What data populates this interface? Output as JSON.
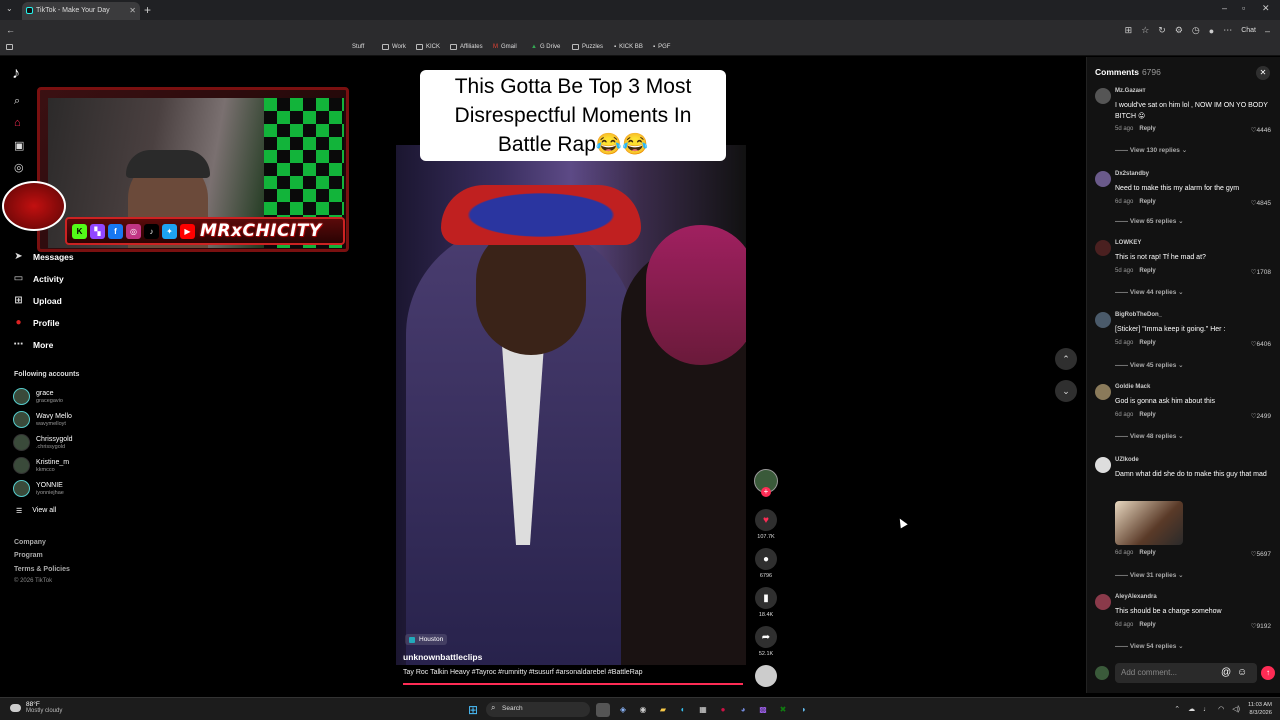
{
  "browser": {
    "tab_title": "TikTok - Make Your Day",
    "bookmarks": [
      "Stuff",
      "Work",
      "KICK",
      "Affiliates",
      "Gmail",
      "G Drive",
      "Puzzles",
      "KICK BB",
      "PGF"
    ],
    "chat_label": "Chat"
  },
  "sidebar": {
    "nav": [
      {
        "label": "Messages",
        "icon": "paper-plane-icon"
      },
      {
        "label": "Activity",
        "icon": "activity-icon"
      },
      {
        "label": "Upload",
        "icon": "upload-icon"
      },
      {
        "label": "Profile",
        "icon": "profile-icon"
      },
      {
        "label": "More",
        "icon": "more-icon"
      }
    ],
    "following_title": "Following accounts",
    "accounts": [
      {
        "name": "grace",
        "handle": "gracegavio"
      },
      {
        "name": "Wavy Mello",
        "handle": "wavymelloyt"
      },
      {
        "name": "Chrissygold",
        "handle": ".chrissygold"
      },
      {
        "name": "Kristine_m",
        "handle": "kkmcco"
      },
      {
        "name": "YONNIE",
        "handle": "iyonniejhae"
      }
    ],
    "view_all": "View all",
    "footer": [
      "Company",
      "Program",
      "Terms & Policies"
    ],
    "copyright": "© 2026 TikTok"
  },
  "overlay": {
    "channel_name": "MRxCHICITY"
  },
  "video": {
    "title_line1": "This Gotta Be Top 3 Most",
    "title_line2": "Disrespectful Moments In",
    "title_line3": "Battle Rap😂😂",
    "location": "Houston",
    "author": "unknownbattleclips",
    "caption": "Tay Roc Talkin Heavy #Tayroc #rumnitty #tsusurf #arsonaldarebel #BattleRap",
    "likes": "107.7K",
    "comments": "6796",
    "saves": "18.4K",
    "shares": "52.1K"
  },
  "comments_panel": {
    "title": "Comments",
    "count": "6796",
    "input_placeholder": "Add comment...",
    "items": [
      {
        "user": "Mz.Gazaнт",
        "text": "I would've sat on him lol , NOW IM ON YO BODY BITCH 😛",
        "age": "5d ago",
        "reply": "Reply",
        "likes": "4446",
        "replies": "View 130 replies"
      },
      {
        "user": "Dx2standby",
        "text": "Need to make this my alarm for the gym",
        "age": "6d ago",
        "reply": "Reply",
        "likes": "4845",
        "replies": "View 65 replies"
      },
      {
        "user": "LOWKEY",
        "text": "This is not rap! Tf he mad at?",
        "age": "5d ago",
        "reply": "Reply",
        "likes": "1708",
        "replies": "View 44 replies"
      },
      {
        "user": "BigRobTheDon_",
        "text": "[Sticker] \"Imma keep it going.\" Her :",
        "age": "5d ago",
        "reply": "Reply",
        "likes": "6406",
        "replies": "View 45 replies"
      },
      {
        "user": "Goldie Mack",
        "text": "God is gonna ask him about this",
        "age": "6d ago",
        "reply": "Reply",
        "likes": "2499",
        "replies": "View 48 replies"
      },
      {
        "user": "UZIkode",
        "text": "Damn what did she do to make this guy that mad",
        "age": "6d ago",
        "reply": "Reply",
        "likes": "5697",
        "replies": "View 31 replies"
      },
      {
        "user": "AleyAlexandra",
        "text": "This should be a charge somehow",
        "age": "6d ago",
        "reply": "Reply",
        "likes": "9192",
        "replies": "View 54 replies"
      }
    ]
  },
  "taskbar": {
    "temp": "88°F",
    "weather": "Mostly cloudy",
    "search": "Search",
    "time": "11:03 AM",
    "date": "8/3/2026"
  }
}
